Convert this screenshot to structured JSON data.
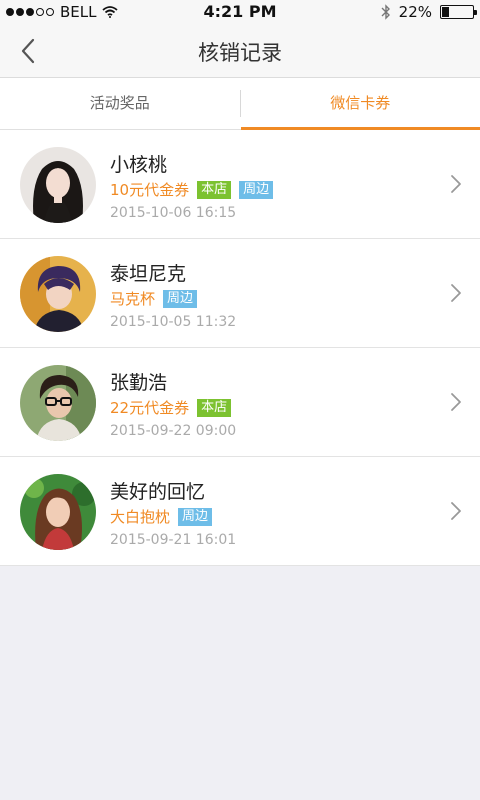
{
  "status": {
    "carrier": "BELL",
    "time": "4:21 PM",
    "battery": "22%",
    "battery_level": 0.22
  },
  "nav": {
    "title": "核销记录"
  },
  "tabs": [
    {
      "label": "活动奖品",
      "active": false
    },
    {
      "label": "微信卡券",
      "active": true
    }
  ],
  "records": [
    {
      "name": "小核桃",
      "prize": "10元代金券",
      "tags": [
        "本店",
        "周边"
      ],
      "date": "2015-10-06 16:15"
    },
    {
      "name": "泰坦尼克",
      "prize": "马克杯",
      "tags": [
        "周边"
      ],
      "date": "2015-10-05 11:32"
    },
    {
      "name": "张勤浩",
      "prize": "22元代金券",
      "tags": [
        "本店"
      ],
      "date": "2015-09-22 09:00"
    },
    {
      "name": "美好的回忆",
      "prize": "大白抱枕",
      "tags": [
        "周边"
      ],
      "date": "2015-09-21 16:01"
    }
  ],
  "colors": {
    "accent": "#f08a24",
    "tag_store": "#7cc230",
    "tag_nearby": "#6ebde8"
  }
}
